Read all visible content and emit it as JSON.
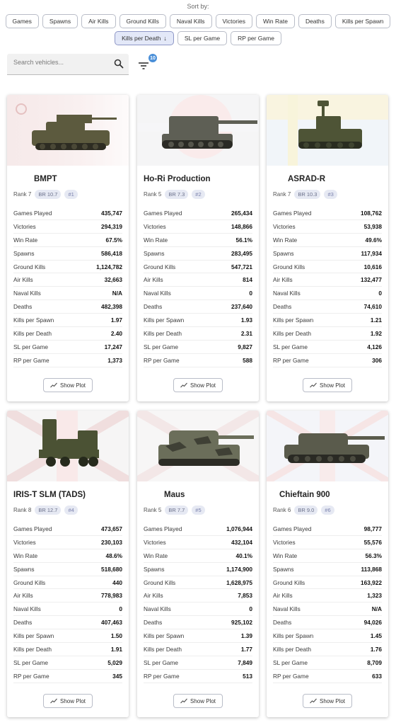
{
  "sort": {
    "label": "Sort by:",
    "options_row1": [
      "Games",
      "Spawns",
      "Air Kills",
      "Ground Kills",
      "Naval Kills",
      "Victories",
      "Win Rate",
      "Deaths",
      "Kills per Spawn"
    ],
    "options_row2": [
      "Kills per Death",
      "SL per Game",
      "RP per Game"
    ],
    "active": "Kills per Death",
    "active_arrow": "↓"
  },
  "search": {
    "placeholder": "Search vehicles...",
    "value": ""
  },
  "filter": {
    "badge_count": "10"
  },
  "stat_labels": {
    "games": "Games Played",
    "victories": "Victories",
    "win_rate": "Win Rate",
    "spawns": "Spawns",
    "ground_kills": "Ground Kills",
    "air_kills": "Air Kills",
    "naval_kills": "Naval Kills",
    "deaths": "Deaths",
    "kills_per_spawn": "Kills per Spawn",
    "kills_per_death": "Kills per Death",
    "sl_per_game": "SL per Game",
    "rp_per_game": "RP per Game"
  },
  "show_plot_label": "Show Plot",
  "vehicles": [
    {
      "name": "BMPT",
      "rank": "Rank 7",
      "br": "BR 10.7",
      "pos": "#1",
      "games": "435,747",
      "victories": "294,319",
      "win_rate": "67.5%",
      "spawns": "586,418",
      "ground_kills": "1,124,782",
      "air_kills": "32,663",
      "naval_kills": "N/A",
      "deaths": "482,398",
      "kills_per_spawn": "1.97",
      "kills_per_death": "2.40",
      "sl_per_game": "17,247",
      "rp_per_game": "1,373"
    },
    {
      "name": "Ho-Ri Production",
      "rank": "Rank 5",
      "br": "BR 7.3",
      "pos": "#2",
      "games": "265,434",
      "victories": "148,866",
      "win_rate": "56.1%",
      "spawns": "283,495",
      "ground_kills": "547,721",
      "air_kills": "814",
      "naval_kills": "0",
      "deaths": "237,640",
      "kills_per_spawn": "1.93",
      "kills_per_death": "2.31",
      "sl_per_game": "9,827",
      "rp_per_game": "588"
    },
    {
      "name": "ASRAD-R",
      "rank": "Rank 7",
      "br": "BR 10.3",
      "pos": "#3",
      "games": "108,762",
      "victories": "53,938",
      "win_rate": "49.6%",
      "spawns": "117,934",
      "ground_kills": "10,616",
      "air_kills": "132,477",
      "naval_kills": "0",
      "deaths": "74,610",
      "kills_per_spawn": "1.21",
      "kills_per_death": "1.92",
      "sl_per_game": "4,126",
      "rp_per_game": "306"
    },
    {
      "name": "IRIS-T SLM (TADS)",
      "rank": "Rank 8",
      "br": "BR 12.7",
      "pos": "#4",
      "games": "473,657",
      "victories": "230,103",
      "win_rate": "48.6%",
      "spawns": "518,680",
      "ground_kills": "440",
      "air_kills": "778,983",
      "naval_kills": "0",
      "deaths": "407,463",
      "kills_per_spawn": "1.50",
      "kills_per_death": "1.91",
      "sl_per_game": "5,029",
      "rp_per_game": "345"
    },
    {
      "name": "Maus",
      "rank": "Rank 5",
      "br": "BR 7.7",
      "pos": "#5",
      "games": "1,076,944",
      "victories": "432,104",
      "win_rate": "40.1%",
      "spawns": "1,174,900",
      "ground_kills": "1,628,975",
      "air_kills": "7,853",
      "naval_kills": "0",
      "deaths": "925,102",
      "kills_per_spawn": "1.39",
      "kills_per_death": "1.77",
      "sl_per_game": "7,849",
      "rp_per_game": "513"
    },
    {
      "name": "Chieftain 900",
      "rank": "Rank 6",
      "br": "BR 9.0",
      "pos": "#6",
      "games": "98,777",
      "victories": "55,576",
      "win_rate": "56.3%",
      "spawns": "113,868",
      "ground_kills": "163,922",
      "air_kills": "1,323",
      "naval_kills": "N/A",
      "deaths": "94,026",
      "kills_per_spawn": "1.45",
      "kills_per_death": "1.76",
      "sl_per_game": "8,709",
      "rp_per_game": "633"
    }
  ]
}
